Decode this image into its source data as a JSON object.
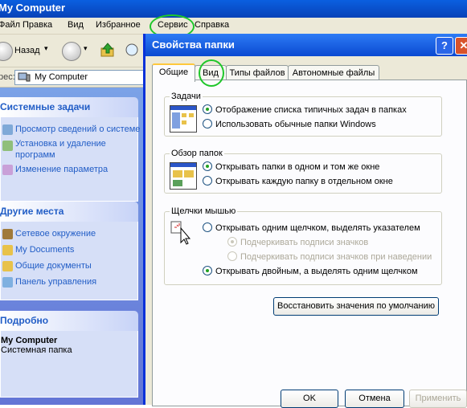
{
  "window": {
    "title": "My Computer"
  },
  "menu": [
    "Файл",
    "Правка",
    "Вид",
    "Избранное",
    "Сервис",
    "Справка"
  ],
  "toolbar": {
    "back_label": "Назад"
  },
  "address": {
    "label": "рес:",
    "value": "My Computer"
  },
  "sidebar": {
    "system_tasks": {
      "title": "Системные задачи",
      "items": [
        "Просмотр сведений о системе",
        "Установка и удаление программ",
        "Изменение параметра"
      ]
    },
    "other_places": {
      "title": "Другие места",
      "items": [
        "Сетевое окружение",
        "My Documents",
        "Общие документы",
        "Панель управления"
      ]
    },
    "details": {
      "title": "Подробно",
      "name": "My Computer",
      "desc": "Системная папка"
    }
  },
  "dialog": {
    "title": "Свойства папки",
    "help_btn": "?",
    "close_btn": "✕",
    "tabs": [
      "Общие",
      "Вид",
      "Типы файлов",
      "Автономные файлы"
    ],
    "tasks": {
      "title": "Задачи",
      "opt1": "Отображение списка типичных задач в папках",
      "opt2": "Использовать обычные папки Windows"
    },
    "browse": {
      "title": "Обзор папок",
      "opt1": "Открывать папки в одном и том же окне",
      "opt2": "Открывать каждую папку в отдельном окне"
    },
    "clicks": {
      "title": "Щелчки мышью",
      "opt1": "Открывать одним щелчком, выделять указателем",
      "sub1": "Подчеркивать подписи значков",
      "sub2": "Подчеркивать подписи значков при наведении",
      "opt2": "Открывать двойным, а выделять одним щелчком"
    },
    "restore_btn": "Восстановить значения по умолчанию",
    "ok": "OK",
    "cancel": "Отмена",
    "apply": "Применить"
  },
  "colors": {
    "xp_blue": "#0a49d1",
    "annotation_green": "#1fc72a",
    "link": "#215dc6"
  }
}
